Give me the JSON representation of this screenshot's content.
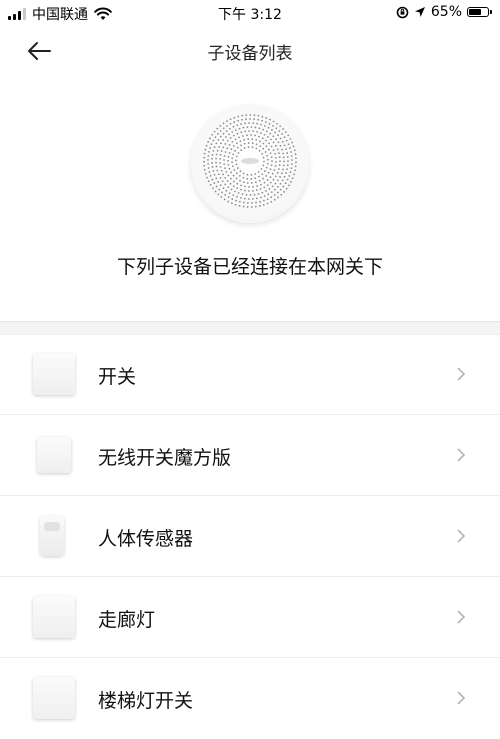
{
  "status_bar": {
    "carrier": "中国联通",
    "time": "下午 3:12",
    "battery": "65%",
    "battery_level": 0.65,
    "icons": [
      "signal-icon",
      "wifi-icon",
      "lock-rotation-icon",
      "location-icon",
      "battery-icon"
    ]
  },
  "nav": {
    "title": "子设备列表",
    "back_icon": "back-arrow-icon"
  },
  "hub": {
    "image": "gateway-hub-image"
  },
  "subtitle": "下列子设备已经连接在本网关下",
  "devices": [
    {
      "name": "开关",
      "icon": "switch-thumbnail"
    },
    {
      "name": "无线开关魔方版",
      "icon": "cube-switch-thumbnail"
    },
    {
      "name": "人体传感器",
      "icon": "motion-sensor-thumbnail"
    },
    {
      "name": "走廊灯",
      "icon": "switch-thumbnail"
    },
    {
      "name": "楼梯灯开关",
      "icon": "switch-thumbnail"
    }
  ],
  "colors": {
    "background": "#ffffff",
    "divider": "#f4f4f4",
    "chevron": "#b5b5b5",
    "text": "#111111"
  }
}
